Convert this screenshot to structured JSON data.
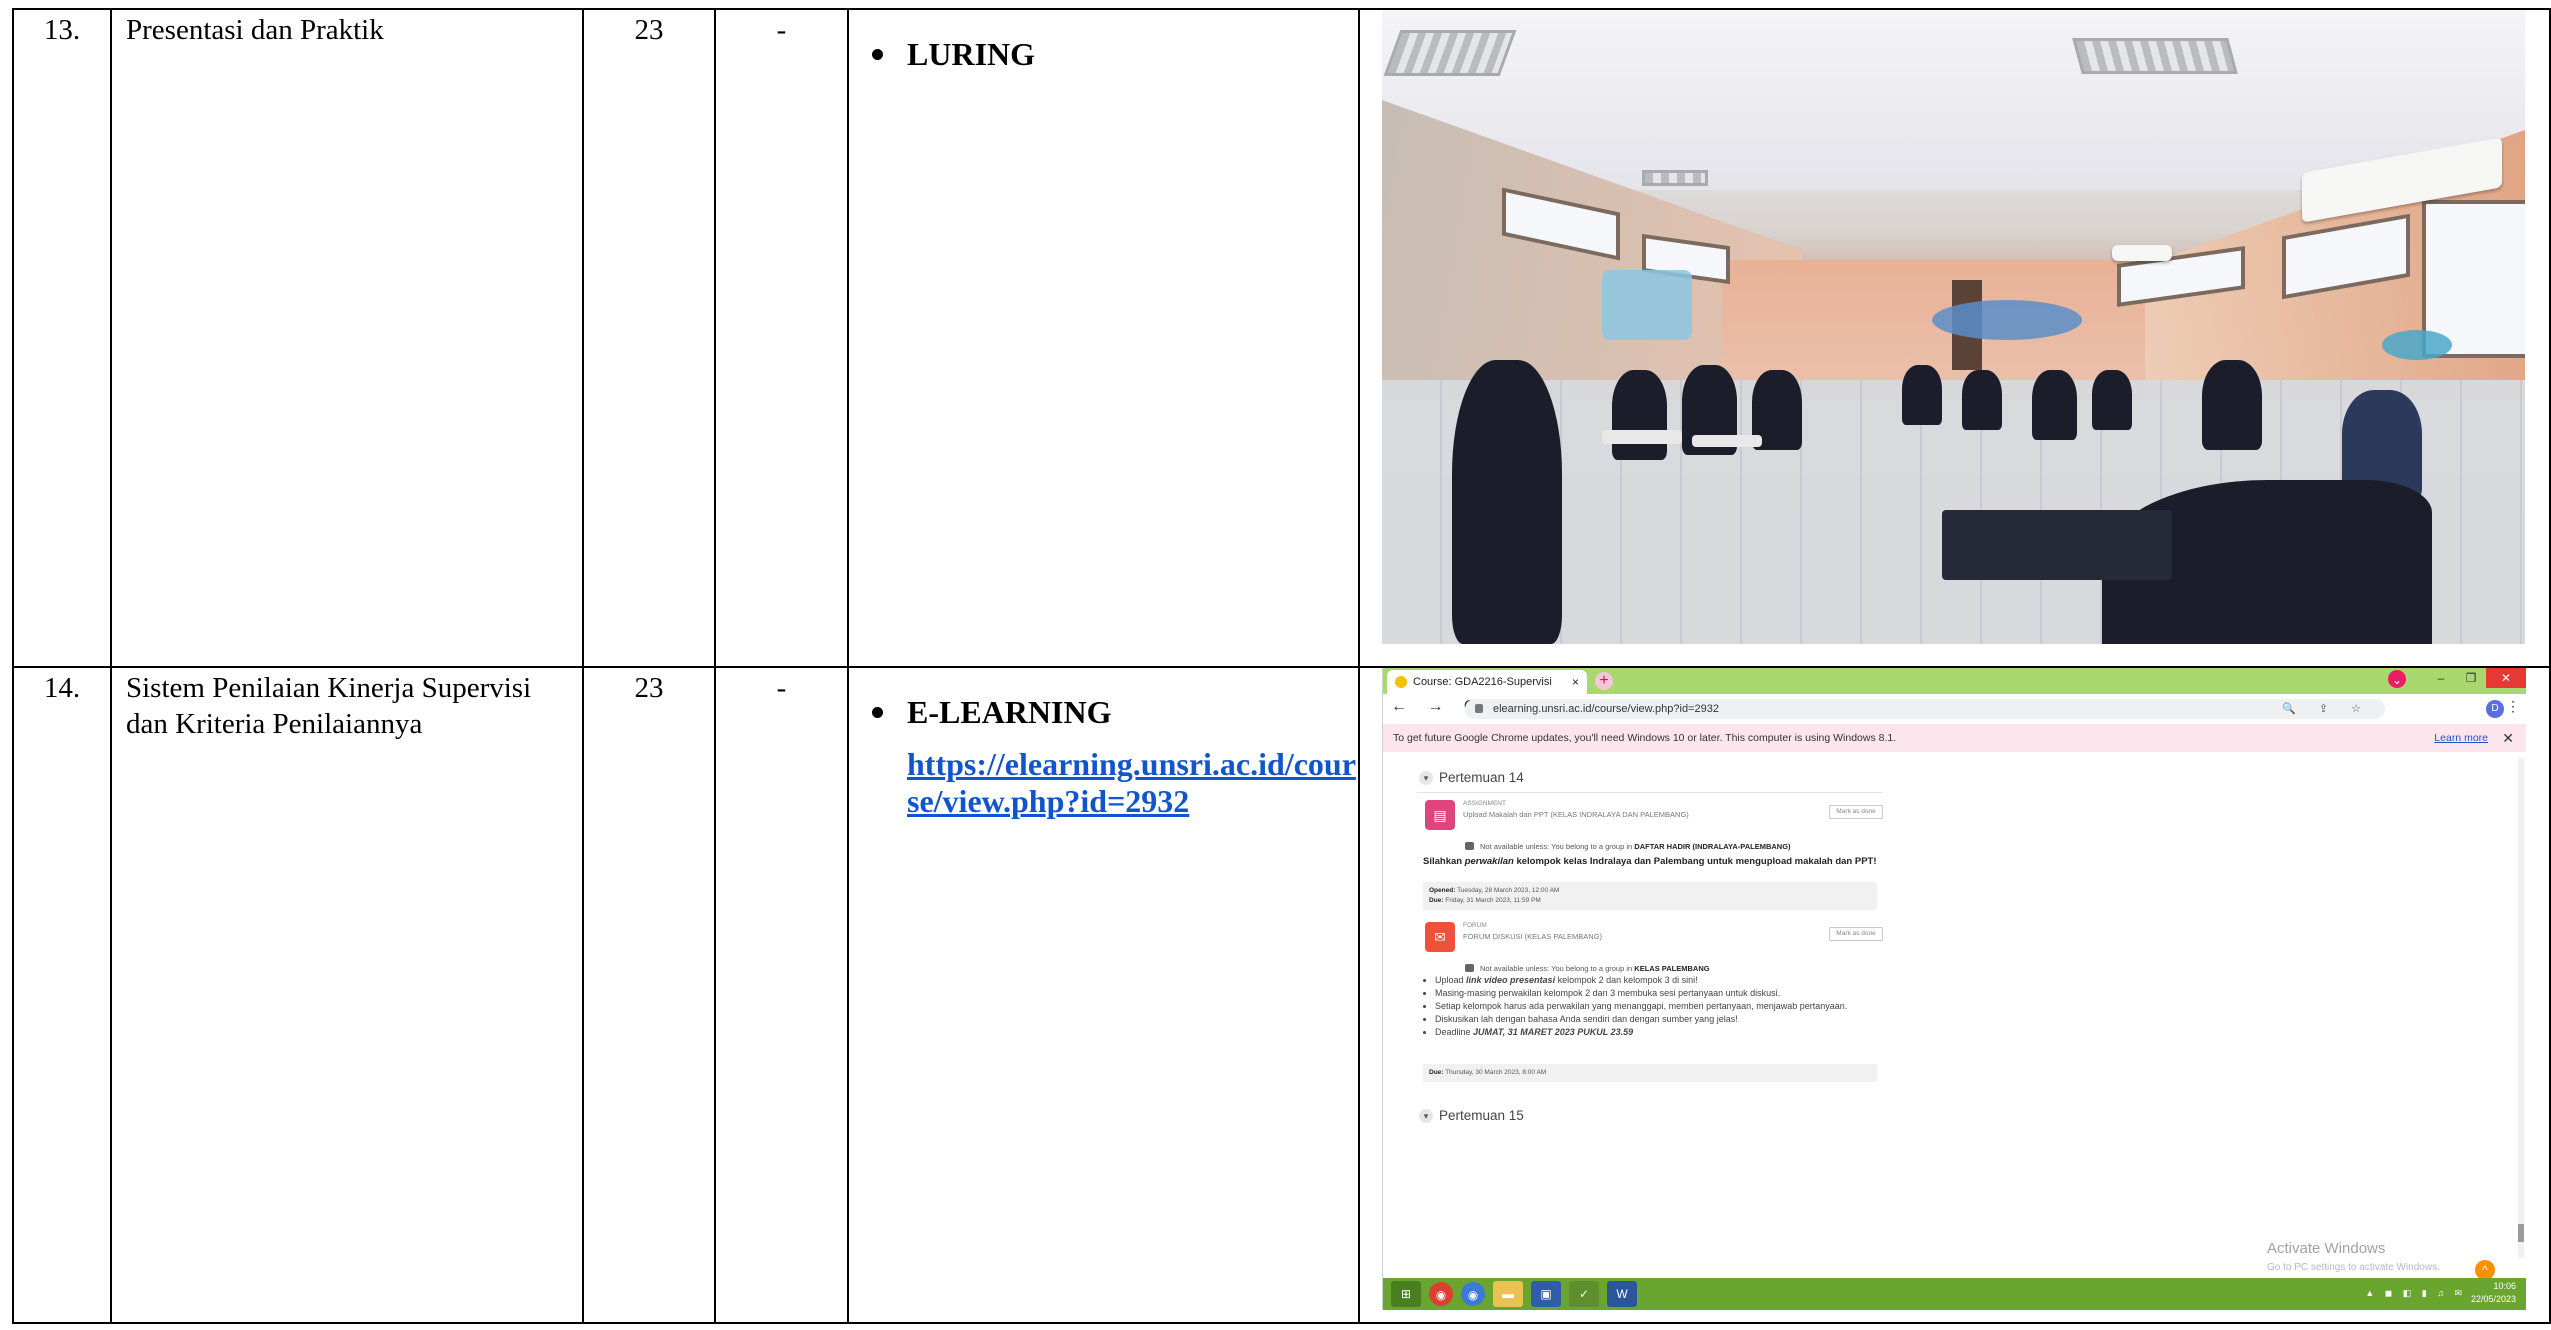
{
  "rows": [
    {
      "no": "13.",
      "topic": "Presentasi dan Praktik",
      "count": "23",
      "dash": "-",
      "mode": "LURING",
      "link": ""
    },
    {
      "no": "14.",
      "topic": "Sistem Penilaian Kinerja Supervisi dan Kriteria Penilaiannya",
      "count": "23",
      "dash": "-",
      "mode": "E-LEARNING",
      "link": "https://elearning.unsri.ac.id/course/view.php?id=2932"
    }
  ],
  "screenshot": {
    "tab_title": "Course: GDA2216-Supervisi",
    "tab_close": "×",
    "new_tab": "+",
    "window_controls": [
      "–",
      "❐",
      "✕"
    ],
    "profile_badge": "⌄",
    "nav_buttons": "← → C",
    "url": "elearning.unsri.ac.id/course/view.php?id=2932",
    "omnibox_tools": "🔍 ⇪ ☆",
    "account_initial": "D",
    "more": "⋮",
    "infobar_text": "To get future Google Chrome updates, you'll need Windows 10 or later. This computer is using Windows 8.1.",
    "infobar_link": "Learn more",
    "infobar_close": "✕",
    "section1": "Pertemuan 14",
    "assignment": {
      "kind": "ASSIGNMENT",
      "name": "Upload Makalah dan PPT (KELAS INDRALAYA DAN PALEMBANG)",
      "mark": "Mark as done",
      "restriction_prefix": "Not available unless: You belong to a group in",
      "restriction_group": "DAFTAR HADIR (INDRALAYA-PALEMBANG)",
      "desc_a": "Silahkan ",
      "desc_em": "perwakilan",
      "desc_b": " kelompok kelas Indralaya dan Palembang untuk mengupload makalah dan PPT!",
      "opened_label": "Opened:",
      "opened_value": "Tuesday, 28 March 2023, 12:00 AM",
      "due_label": "Due:",
      "due_value": "Friday, 31 March 2023, 11:59 PM"
    },
    "forum": {
      "kind": "FORUM",
      "name": "FORUM DISKUSI (KELAS PALEMBANG)",
      "mark": "Mark as done",
      "restriction_prefix": "Not available unless: You belong to a group in",
      "restriction_group": "KELAS PALEMBANG",
      "bullet1_a": "Upload ",
      "bullet1_em": "link video presentasi",
      "bullet1_b": " kelompok 2 dan kelompok 3 di sini!",
      "bullet2": "Masing-masing perwakilan kelompok 2 dan 3 membuka sesi pertanyaan untuk diskusi.",
      "bullet3": "Setiap kelompok harus ada perwakilan yang menanggapi, memberi pertanyaan, menjawab pertanyaan.",
      "bullet4": "Diskusikan lah dengan bahasa Anda sendiri dan dengan sumber yang jelas!",
      "bullet5_a": "Deadline ",
      "bullet5_em": "JUMAT, 31 MARET 2023 PUKUL 23.59",
      "due_label": "Due:",
      "due_value": "Thursday, 30 March 2023, 8:00 AM"
    },
    "section2": "Pertemuan 15",
    "watermark_title": "Activate Windows",
    "watermark_sub": "Go to PC settings to activate Windows.",
    "scroll_up": "^",
    "taskbar_time": "10:06",
    "taskbar_date": "22/05/2023"
  },
  "colors": {
    "link": "#1155cc",
    "chrome_tabbar": "#a9d86e",
    "infobar": "#fde5ee",
    "assignment_icon": "#e0447c",
    "forum_icon": "#f0513a",
    "taskbar": "#6aa52f"
  }
}
